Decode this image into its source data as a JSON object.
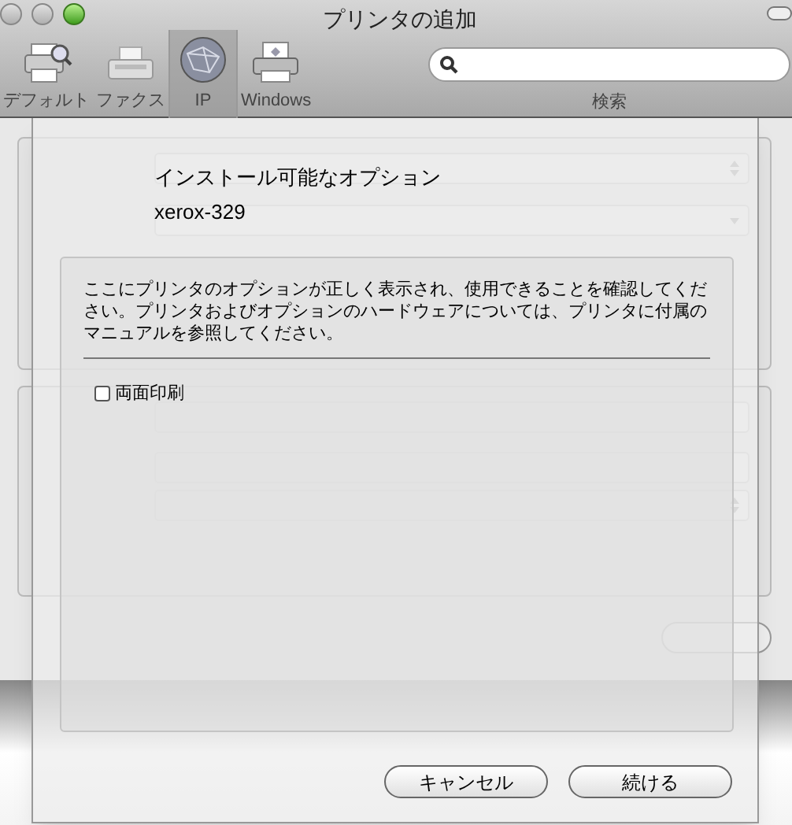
{
  "window": {
    "title": "プリンタの追加"
  },
  "toolbar": {
    "items": [
      {
        "label": "デフォルト",
        "kind": "default",
        "selected": false
      },
      {
        "label": "ファクス",
        "kind": "fax",
        "selected": false
      },
      {
        "label": "IP",
        "kind": "ip",
        "selected": true
      },
      {
        "label": "Windows",
        "kind": "windows",
        "selected": false
      }
    ],
    "search": {
      "label": "検索"
    }
  },
  "background_form": {
    "fields": [
      {
        "kind": "popup"
      },
      {
        "kind": "combo"
      },
      {
        "kind": "text"
      },
      {
        "kind": "text"
      },
      {
        "kind": "popup"
      }
    ]
  },
  "sheet": {
    "heading": "インストール可能なオプション",
    "printer_name": "xerox-329",
    "description": "ここにプリンタのオプションが正しく表示され、使用できることを確認してください。プリンタおよびオプションのハードウェアについては、プリンタに付属のマニュアルを参照してください。",
    "options": [
      {
        "label": "両面印刷",
        "checked": false
      }
    ],
    "buttons": [
      {
        "label": "キャンセル"
      },
      {
        "label": "続ける"
      }
    ]
  }
}
